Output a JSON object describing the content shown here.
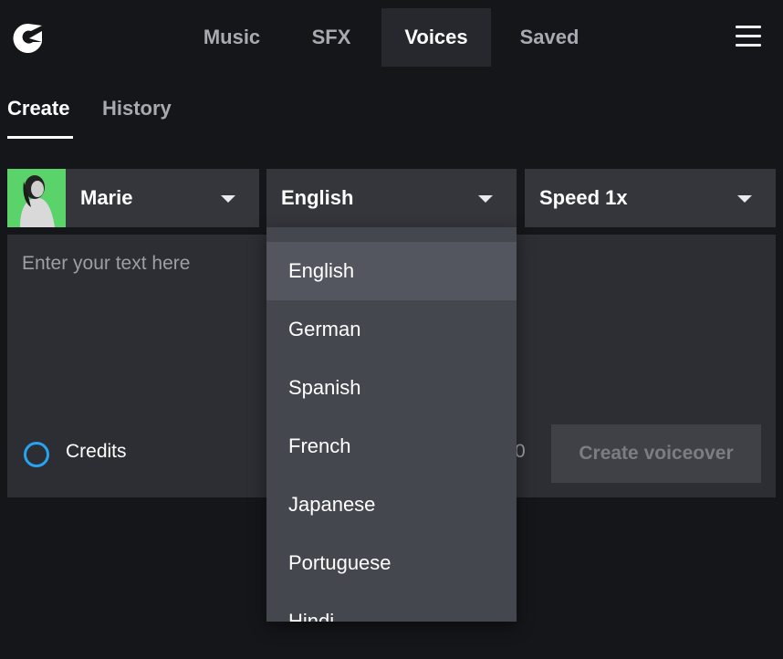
{
  "nav": {
    "items": [
      {
        "label": "Music"
      },
      {
        "label": "SFX"
      },
      {
        "label": "Voices"
      },
      {
        "label": "Saved"
      }
    ],
    "active": "Voices"
  },
  "subtabs": [
    {
      "label": "Create"
    },
    {
      "label": "History"
    }
  ],
  "voice_select": {
    "value": "Marie"
  },
  "language_select": {
    "value": "English"
  },
  "speed_select": {
    "value": "Speed 1x"
  },
  "editor": {
    "placeholder": "Enter your text here",
    "credits_label": "Credits",
    "char_count": "0",
    "create_button": "Create voiceover"
  },
  "language_options": [
    {
      "label": "English"
    },
    {
      "label": "German"
    },
    {
      "label": "Spanish"
    },
    {
      "label": "French"
    },
    {
      "label": "Japanese"
    },
    {
      "label": "Portuguese"
    },
    {
      "label": "Hindi"
    }
  ],
  "colors": {
    "background": "#151619",
    "accent_circle": "#27a3f0",
    "avatar_bg": "#5bd36b"
  },
  "icons": {
    "logo": "brand-logo-icon",
    "menu": "hamburger-menu-icon",
    "caret": "caret-down-icon"
  }
}
